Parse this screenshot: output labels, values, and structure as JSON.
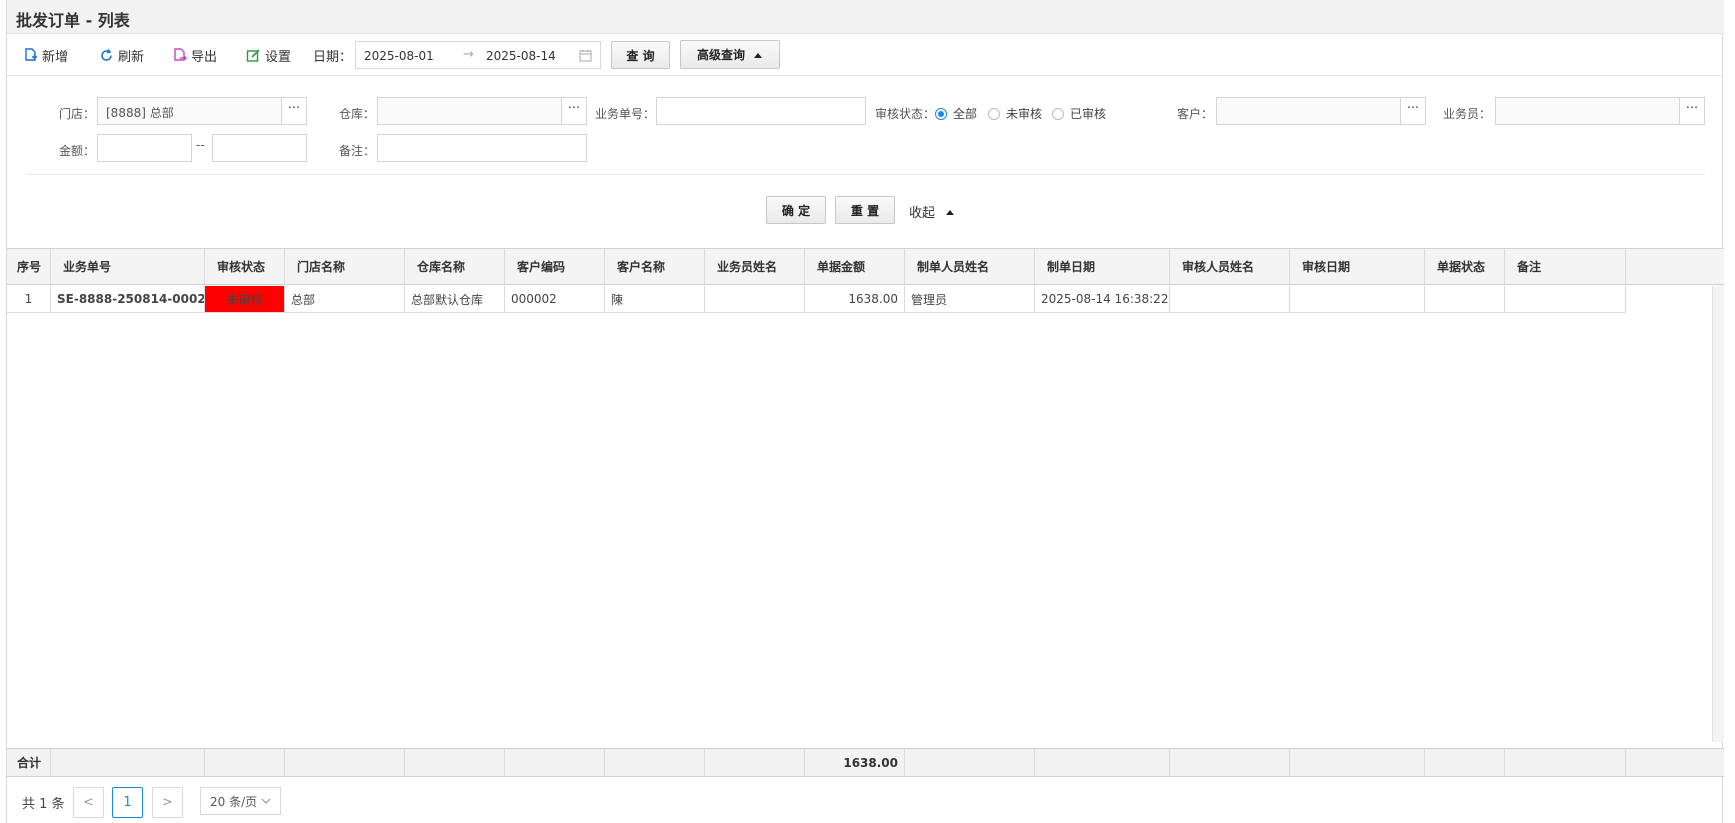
{
  "page": {
    "title": "批发订单 - 列表"
  },
  "toolbar": {
    "add": "新增",
    "refresh": "刷新",
    "export": "导出",
    "settings": "设置",
    "date_label": "日期：",
    "date_from": "2025-08-01",
    "date_to": "2025-08-14",
    "date_sep": "→",
    "query": "查 询",
    "advanced": "高级查询"
  },
  "filter": {
    "store_label": "门店：",
    "store_value": "[8888] 总部",
    "warehouse_label": "仓库：",
    "warehouse_value": "",
    "bizno_label": "业务单号：",
    "bizno_value": "",
    "audit_label": "审核状态：",
    "audit_options": [
      "全部",
      "未审核",
      "已审核"
    ],
    "audit_selected": "全部",
    "customer_label": "客户：",
    "customer_value": "",
    "salesman_label": "业务员：",
    "salesman_value": "",
    "amount_label": "金额：",
    "amount_from": "",
    "amount_sep": "--",
    "amount_to": "",
    "remark_label": "备注：",
    "remark_value": "",
    "ellipsis": "···",
    "confirm": "确 定",
    "reset": "重 置",
    "collapse": "收起"
  },
  "table": {
    "columns": [
      "序号",
      "业务单号",
      "审核状态",
      "门店名称",
      "仓库名称",
      "客户编码",
      "客户名称",
      "业务员姓名",
      "单据金额",
      "制单人员姓名",
      "制单日期",
      "审核人员姓名",
      "审核日期",
      "单据状态",
      "备注"
    ],
    "rows": [
      [
        "1",
        "SE-8888-250814-0002",
        "未审核",
        "总部",
        "总部默认仓库",
        "000002",
        "陳",
        "",
        "1638.00",
        "管理员",
        "2025-08-14 16:38:22",
        "",
        "",
        "",
        ""
      ]
    ],
    "footer_label": "合计",
    "footer_amount": "1638.00"
  },
  "pager": {
    "total": "共 1 条",
    "current_page": "1",
    "prev": "<",
    "next": ">",
    "page_size": "20 条/页"
  },
  "colors": {
    "accent": "#1e88e5",
    "unaudited": "#ff0000",
    "link": "#1f6fb5"
  }
}
